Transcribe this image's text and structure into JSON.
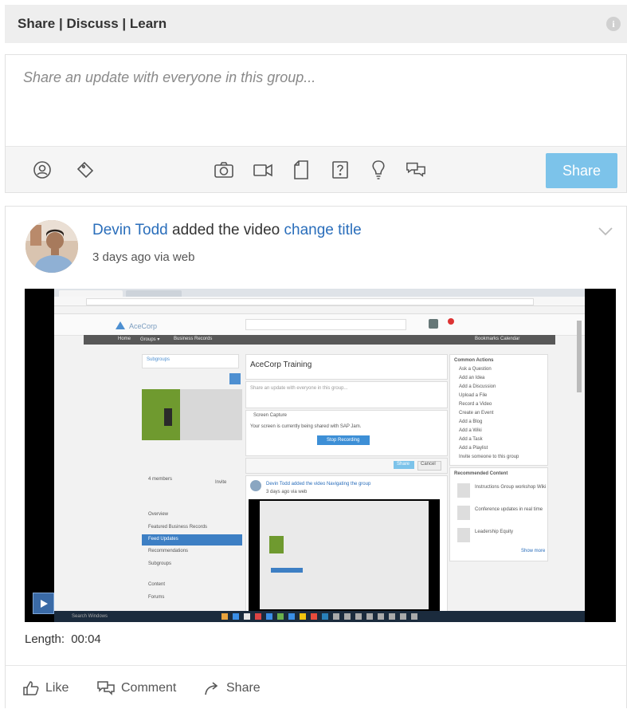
{
  "header": {
    "title": "Share | Discuss | Learn",
    "info_icon": "info-icon"
  },
  "composer": {
    "placeholder": "Share an update with everyone in this group...",
    "tools": [
      "mention-icon",
      "tag-icon",
      "camera-icon",
      "video-icon",
      "document-icon",
      "question-icon",
      "idea-icon",
      "discussion-icon"
    ],
    "share_label": "Share",
    "share_color": "#7cc3ea"
  },
  "post": {
    "author": "Devin Todd",
    "action_text": "added the video",
    "object_link": "change title",
    "meta": "3 days ago via web",
    "video": {
      "length_label": "Length:",
      "length_value": "00:04",
      "screen": {
        "brand": "AceCorp",
        "nav": [
          "Home",
          "Groups ▾",
          "Business Records"
        ],
        "nav_right": [
          "Bookmarks",
          "Calendar"
        ],
        "subgroups_label": "Subgroups",
        "group_title": "AceCorp Training",
        "composer_placeholder": "Share an update with everyone in this group...",
        "screen_capture_label": "Screen Capture",
        "screen_capture_text": "Your screen is currently being shared with SAP Jam.",
        "stop_recording": "Stop Recording",
        "share_label": "Share",
        "cancel_label": "Cancel",
        "inner_post": "Devin Todd added the video Navigating the group",
        "inner_meta": "3 days ago via web",
        "side_items": [
          "Overview",
          "Featured Business Records",
          "Feed Updates",
          "Recommendations",
          "Subgroups",
          "Content",
          "Forums"
        ],
        "members_label": "4 members",
        "invite_label": "Invite",
        "common_actions_title": "Common Actions",
        "common_actions": [
          "Ask a Question",
          "Add an Idea",
          "Add a Discussion",
          "Upload a File",
          "Record a Video",
          "Create an Event",
          "Add a Blog",
          "Add a Wiki",
          "Add a Task",
          "Add a Playlist",
          "Invite someone to this group"
        ],
        "recommended_title": "Recommended Content",
        "recommended_items": [
          "Instructions Group workshop Wiki",
          "Conference updates in real time",
          "Leadership Equity"
        ],
        "show_more": "Show more",
        "taskbar_search": "Search Windows"
      }
    },
    "actions": {
      "like": "Like",
      "comment": "Comment",
      "share": "Share"
    }
  }
}
